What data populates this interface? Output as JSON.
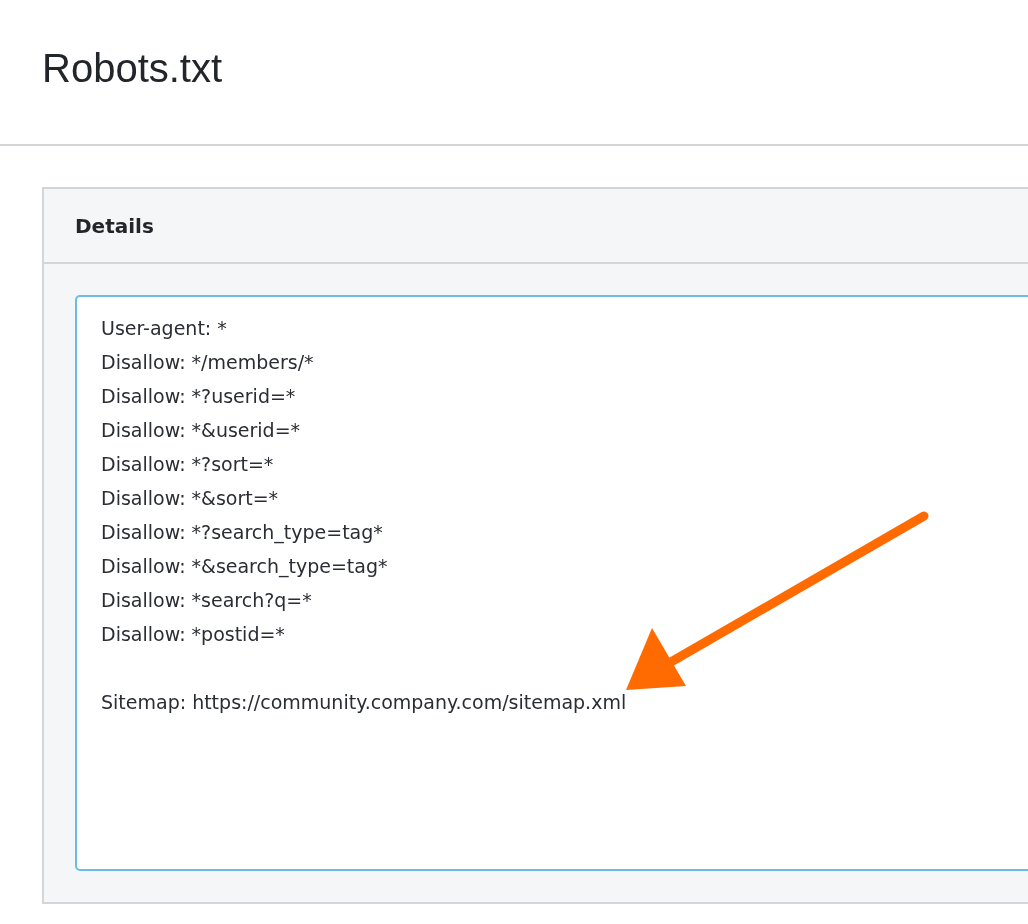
{
  "page": {
    "title": "Robots.txt"
  },
  "panel": {
    "title": "Details",
    "content": "User-agent: *\nDisallow: */members/*\nDisallow: *?userid=*\nDisallow: *&userid=*\nDisallow: *?sort=*\nDisallow: *&sort=*\nDisallow: *?search_type=tag*\nDisallow: *&search_type=tag*\nDisallow: *search?q=*\nDisallow: *postid=*\n\nSitemap: https://community.company.com/sitemap.xml"
  }
}
